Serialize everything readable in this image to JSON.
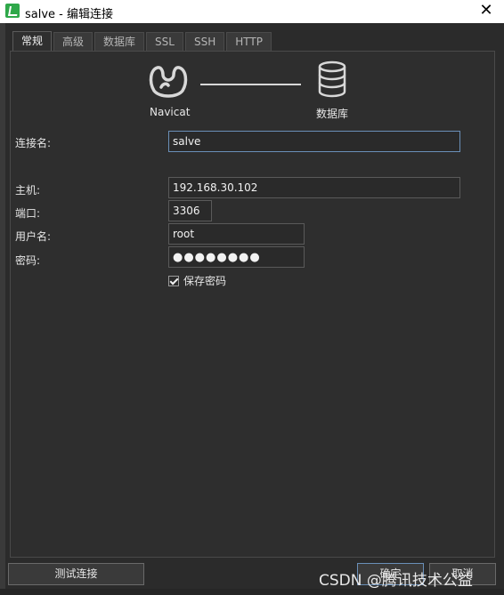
{
  "window": {
    "title": "salve - 编辑连接",
    "close_label": "✕"
  },
  "tabs": [
    {
      "label": "常规",
      "active": true
    },
    {
      "label": "高级"
    },
    {
      "label": "数据库"
    },
    {
      "label": "SSL"
    },
    {
      "label": "SSH"
    },
    {
      "label": "HTTP"
    }
  ],
  "header": {
    "left_label": "Navicat",
    "right_label": "数据库"
  },
  "form": {
    "connection_name": {
      "label": "连接名:",
      "value": "salve"
    },
    "host": {
      "label": "主机:",
      "value": "192.168.30.102"
    },
    "port": {
      "label": "端口:",
      "value": "3306"
    },
    "username": {
      "label": "用户名:",
      "value": "root"
    },
    "password": {
      "label": "密码:",
      "value": "●●●●●●●●"
    },
    "save_password": {
      "label": "保存密码",
      "checked": true
    }
  },
  "buttons": {
    "test": "测试连接",
    "ok": "确定",
    "cancel": "取消"
  },
  "watermark": "CSDN @腾讯技术公益"
}
